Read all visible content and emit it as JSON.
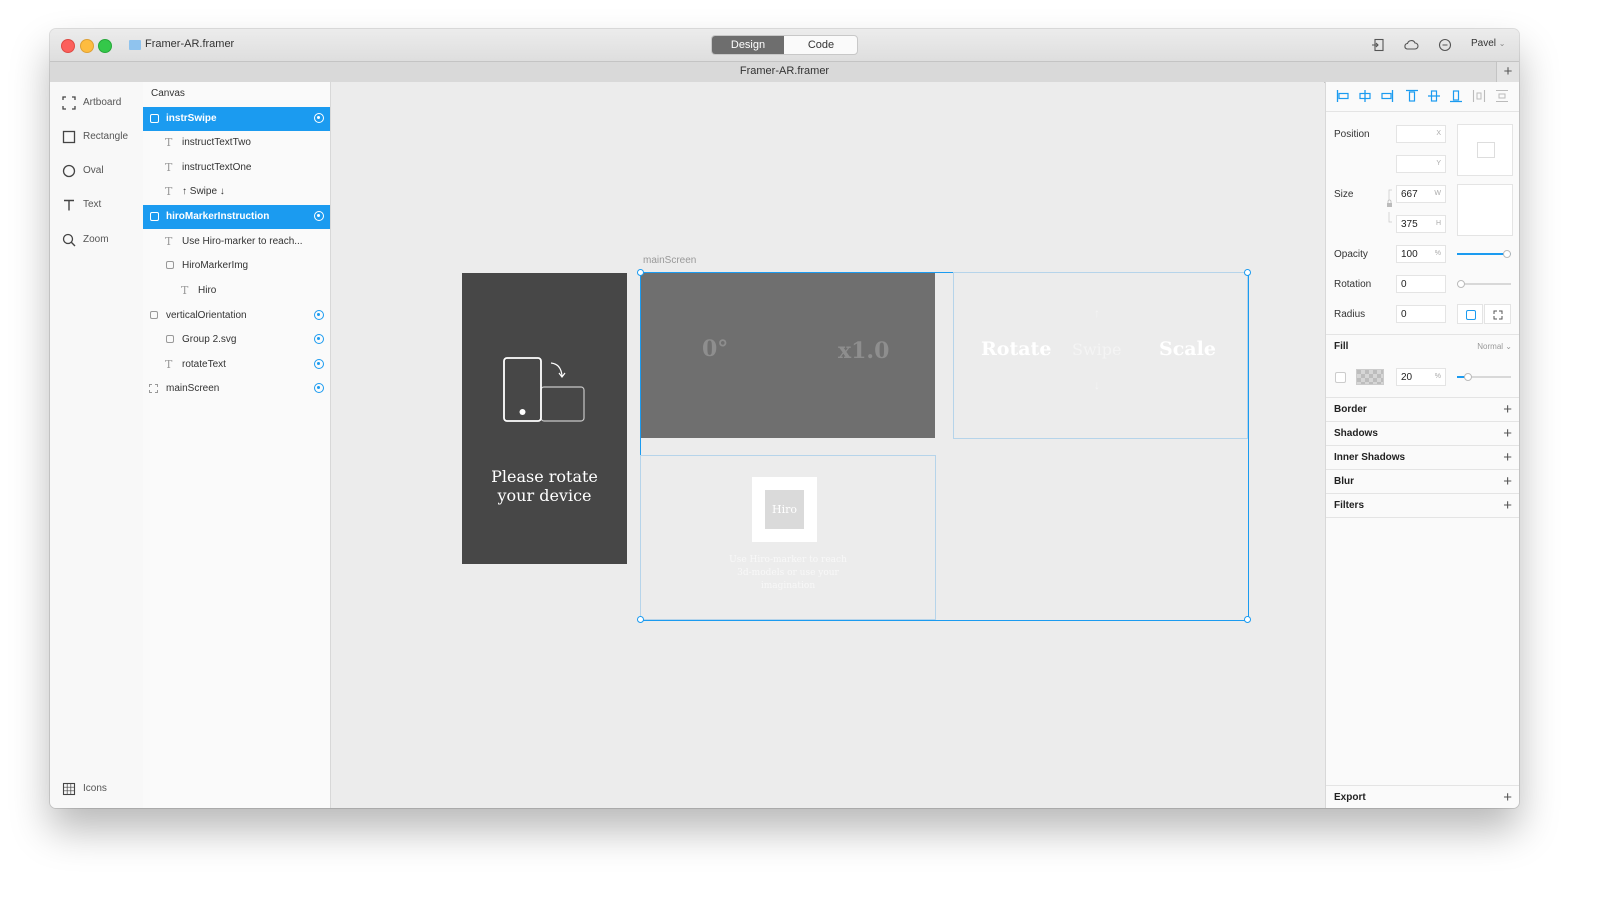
{
  "window": {
    "title": "Framer-AR.framer",
    "user": "Pavel"
  },
  "mode_tabs": {
    "design": "Design",
    "code": "Code",
    "active": "Design"
  },
  "document_tab": {
    "title": "Framer-AR.framer"
  },
  "tools": [
    {
      "label": "Artboard",
      "icon": "artboard-icon"
    },
    {
      "label": "Rectangle",
      "icon": "rectangle-icon"
    },
    {
      "label": "Oval",
      "icon": "oval-icon"
    },
    {
      "label": "Text",
      "icon": "text-icon"
    },
    {
      "label": "Zoom",
      "icon": "zoom-icon"
    }
  ],
  "tools_bottom": {
    "label": "Icons",
    "icon": "grid-icon"
  },
  "layers": {
    "header": "Canvas",
    "items": [
      {
        "label": "instrSwipe",
        "type": "frame",
        "selected": true,
        "visible": true
      },
      {
        "label": "instructTextTwo",
        "type": "text",
        "selected": false,
        "visible": false
      },
      {
        "label": "instructTextOne",
        "type": "text",
        "selected": false,
        "visible": false
      },
      {
        "label": "↑ Swipe ↓",
        "type": "text",
        "selected": false,
        "visible": false
      },
      {
        "label": "hiroMarkerInstruction",
        "type": "frame",
        "selected": true,
        "visible": true
      },
      {
        "label": "Use Hiro-marker to reach...",
        "type": "text",
        "selected": false,
        "visible": false
      },
      {
        "label": "HiroMarkerImg",
        "type": "frame",
        "selected": false,
        "visible": false
      },
      {
        "label": "Hiro",
        "type": "text",
        "selected": false,
        "visible": false
      },
      {
        "label": "verticalOrientation",
        "type": "frame",
        "selected": false,
        "visible": true
      },
      {
        "label": "Group 2.svg",
        "type": "frame",
        "selected": false,
        "visible": true
      },
      {
        "label": "rotateText",
        "type": "text",
        "selected": false,
        "visible": true
      },
      {
        "label": "mainScreen",
        "type": "artboard",
        "selected": false,
        "visible": true
      }
    ]
  },
  "canvas": {
    "artboard_label": "mainScreen",
    "rotate_screen": {
      "text_line1": "Please rotate",
      "text_line2": "your device"
    },
    "gauge_card": {
      "angle": "0°",
      "scale": "x1.0"
    },
    "swipe_card": {
      "left": "Rotate",
      "middle": "Swipe",
      "right": "Scale",
      "arrow_up": "↑",
      "arrow_down": "↓"
    },
    "hiro_card": {
      "marker_text": "Hiro",
      "line1": "Use Hiro-marker to reach",
      "line2": "3d-models or use your",
      "line3": "imagination"
    }
  },
  "properties": {
    "position": {
      "label": "Position",
      "x": "",
      "x_unit": "X",
      "y": "",
      "y_unit": "Y"
    },
    "size": {
      "label": "Size",
      "w": "667",
      "w_unit": "W",
      "h": "375",
      "h_unit": "H"
    },
    "opacity": {
      "label": "Opacity",
      "value": "100",
      "unit": "%",
      "level": 1.0
    },
    "rotation": {
      "label": "Rotation",
      "value": "0",
      "level": 0.0
    },
    "radius": {
      "label": "Radius",
      "value": "0"
    },
    "fill": {
      "label": "Fill",
      "blend": "Normal",
      "value": "20",
      "unit": "%",
      "level": 0.2
    },
    "sections": [
      "Border",
      "Shadows",
      "Inner Shadows",
      "Blur",
      "Filters"
    ],
    "export": "Export"
  },
  "colors": {
    "accent": "#1b9bf0",
    "canvas_bg": "#ececec",
    "dark_screen": "#474747",
    "gauge_card": "#6f6f6f"
  }
}
